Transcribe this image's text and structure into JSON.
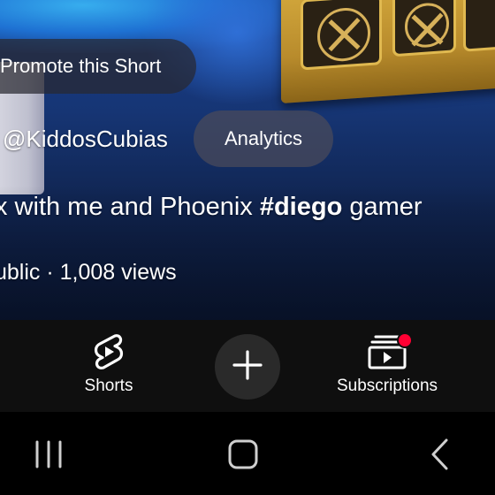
{
  "video": {
    "promote_label": "Promote this Short",
    "channel_handle": "@KiddosCubias",
    "analytics_label": "Analytics",
    "title_prefix": "x with me and Phoenix ",
    "title_hashtag": "#diego",
    "title_suffix": " gamer",
    "stats": "ublic · 1,008 views"
  },
  "bottom_nav": {
    "items": [
      {
        "label": "Shorts",
        "icon": "shorts-icon"
      },
      {
        "label": "",
        "icon": "plus-icon"
      },
      {
        "label": "Subscriptions",
        "icon": "subscriptions-icon",
        "has_notification": true
      }
    ]
  },
  "system_nav": {
    "buttons": [
      "recents-icon",
      "home-icon",
      "back-icon"
    ]
  },
  "colors": {
    "nav_background": "#0f0f0f",
    "notification_dot": "#ff0033",
    "create_button_bg": "#2a2a2a"
  }
}
